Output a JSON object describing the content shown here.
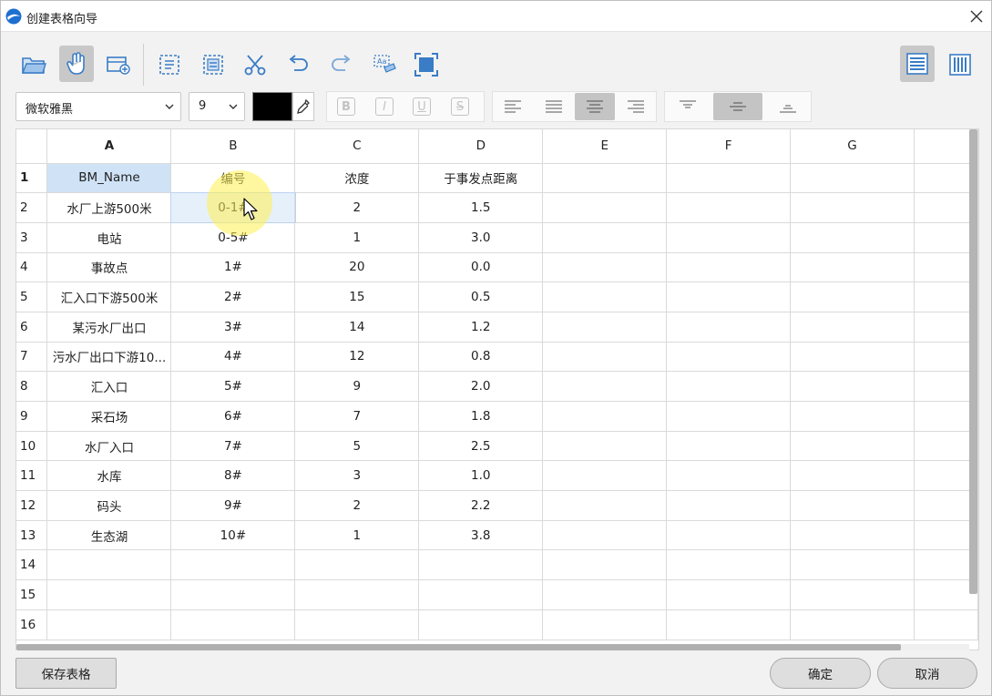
{
  "window": {
    "title": "创建表格向导"
  },
  "toolbar": {
    "buttons": [
      {
        "name": "open-folder-icon"
      },
      {
        "name": "hand-select-icon",
        "active": true
      },
      {
        "name": "insert-table-icon"
      },
      {
        "name": "copy-format-icon"
      },
      {
        "name": "paste-format-icon"
      },
      {
        "name": "cut-icon"
      },
      {
        "name": "undo-icon"
      },
      {
        "name": "redo-icon"
      },
      {
        "name": "find-replace-icon"
      },
      {
        "name": "fit-window-icon"
      }
    ],
    "view_buttons": [
      {
        "name": "row-layout-icon",
        "active": true
      },
      {
        "name": "column-layout-icon",
        "active": false
      }
    ]
  },
  "format": {
    "font": "微软雅黑",
    "size": "9",
    "color": "#000000",
    "bold": "B",
    "italic": "I",
    "underline": "U",
    "strike": "S",
    "halign_active": "center",
    "valign_active": "middle"
  },
  "grid": {
    "columns": [
      "A",
      "B",
      "C",
      "D",
      "E",
      "F",
      "G",
      ""
    ],
    "rows": [
      {
        "n": "1",
        "cells": [
          "BM_Name",
          "编号",
          "浓度",
          "于事发点距离",
          "",
          "",
          "",
          ""
        ]
      },
      {
        "n": "2",
        "cells": [
          "水厂上游500米",
          "0-1#",
          "2",
          "1.5",
          "",
          "",
          "",
          ""
        ]
      },
      {
        "n": "3",
        "cells": [
          "电站",
          "0-5#",
          "1",
          "3.0",
          "",
          "",
          "",
          ""
        ]
      },
      {
        "n": "4",
        "cells": [
          "事故点",
          "1#",
          "20",
          "0.0",
          "",
          "",
          "",
          ""
        ]
      },
      {
        "n": "5",
        "cells": [
          "汇入口下游500米",
          "2#",
          "15",
          "0.5",
          "",
          "",
          "",
          ""
        ]
      },
      {
        "n": "6",
        "cells": [
          "某污水厂出口",
          "3#",
          "14",
          "1.2",
          "",
          "",
          "",
          ""
        ]
      },
      {
        "n": "7",
        "cells": [
          "污水厂出口下游10...",
          "4#",
          "12",
          "0.8",
          "",
          "",
          "",
          ""
        ]
      },
      {
        "n": "8",
        "cells": [
          "汇入口",
          "5#",
          "9",
          "2.0",
          "",
          "",
          "",
          ""
        ]
      },
      {
        "n": "9",
        "cells": [
          "采石场",
          "6#",
          "7",
          "1.8",
          "",
          "",
          "",
          ""
        ]
      },
      {
        "n": "10",
        "cells": [
          "水厂入口",
          "7#",
          "5",
          "2.5",
          "",
          "",
          "",
          ""
        ]
      },
      {
        "n": "11",
        "cells": [
          "水库",
          "8#",
          "3",
          "1.0",
          "",
          "",
          "",
          ""
        ]
      },
      {
        "n": "12",
        "cells": [
          "码头",
          "9#",
          "2",
          "2.2",
          "",
          "",
          "",
          ""
        ]
      },
      {
        "n": "13",
        "cells": [
          "生态湖",
          "10#",
          "1",
          "3.8",
          "",
          "",
          "",
          ""
        ]
      },
      {
        "n": "14",
        "cells": [
          "",
          "",
          "",
          "",
          "",
          "",
          "",
          ""
        ]
      },
      {
        "n": "15",
        "cells": [
          "",
          "",
          "",
          "",
          "",
          "",
          "",
          ""
        ]
      },
      {
        "n": "16",
        "cells": [
          "",
          "",
          "",
          "",
          "",
          "",
          "",
          ""
        ]
      }
    ]
  },
  "footer": {
    "save_label": "保存表格",
    "ok_label": "确定",
    "cancel_label": "取消"
  }
}
